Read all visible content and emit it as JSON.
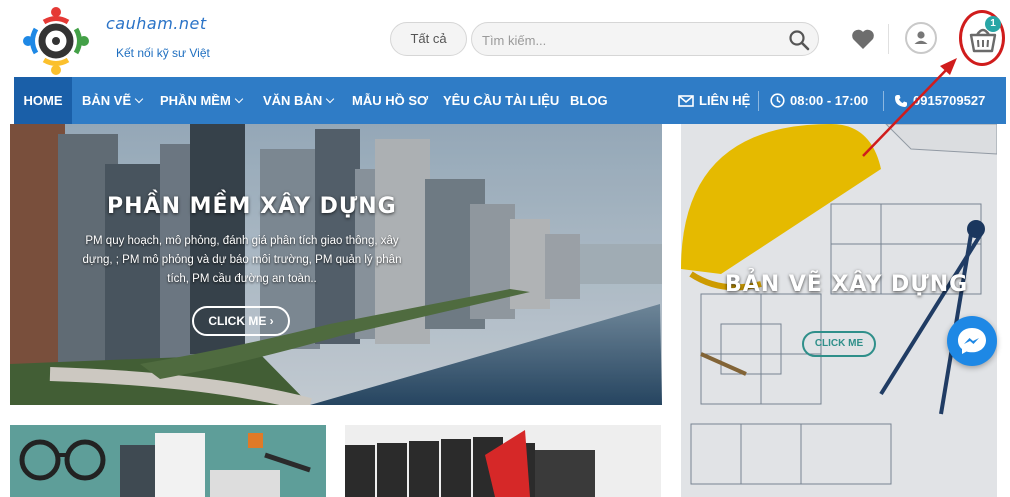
{
  "header": {
    "brand": "cauham.net",
    "tagline": "Kết nối kỹ sư Việt",
    "category_select": "Tất cả",
    "search_placeholder": "Tìm kiếm...",
    "cart_count": "1"
  },
  "nav": {
    "items": [
      {
        "label": "HOME"
      },
      {
        "label": "BẢN VẼ"
      },
      {
        "label": "PHẦN MỀM"
      },
      {
        "label": "VĂN BẢN"
      },
      {
        "label": "MẪU HỒ SƠ"
      },
      {
        "label": "YÊU CẦU TÀI LIỆU"
      },
      {
        "label": "BLOG"
      }
    ],
    "contact": "LIÊN HỆ",
    "hours": "08:00 - 17:00",
    "phone": "0915709527"
  },
  "banners": {
    "left": {
      "title": "PHẦN MỀM XÂY DỰNG",
      "desc_line1": "PM quy hoạch, mô phỏng, đánh giá phân tích giao thông, xây",
      "desc_line2": "dựng, ; PM mô phỏng và dự báo môi trường, PM quản lý phân",
      "desc_line3": "tích, PM cầu đường an toàn..",
      "button": "CLICK ME"
    },
    "right": {
      "title": "BẢN VẼ XÂY DỰNG",
      "button": "CLICK ME"
    }
  },
  "colors": {
    "nav_bg": "#2f7cc6",
    "nav_active": "#1a5fa8",
    "brand": "#2a73c7",
    "badge": "#28a6a6",
    "highlight": "#d01c1c"
  },
  "icons": [
    "logo-icon",
    "search-icon",
    "heart-icon",
    "user-icon",
    "cart-icon",
    "envelope-icon",
    "clock-icon",
    "phone-icon",
    "messenger-icon",
    "chevron-down-icon"
  ]
}
